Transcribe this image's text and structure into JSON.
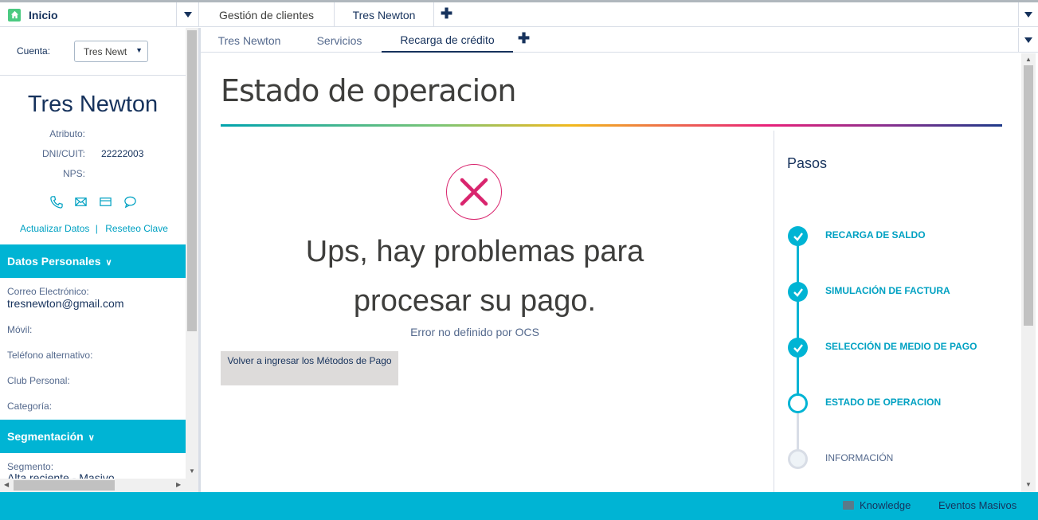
{
  "tabs": {
    "home": "Inicio",
    "workspace": [
      "Gestión de clientes",
      "Tres Newton"
    ]
  },
  "subtabs": [
    "Tres Newton",
    "Servicios",
    "Recarga de crédito"
  ],
  "account": {
    "label": "Cuenta:",
    "selected": "Tres Newt"
  },
  "customer": {
    "name": "Tres Newton",
    "attributes": [
      {
        "label": "Atributo:",
        "value": ""
      },
      {
        "label": "DNI/CUIT:",
        "value": "22222003"
      },
      {
        "label": "NPS:",
        "value": ""
      }
    ],
    "links": {
      "update": "Actualizar Datos",
      "sep": "|",
      "reset": "Reseteo Clave"
    }
  },
  "personal": {
    "title": "Datos Personales",
    "email_label": "Correo Electrónico:",
    "email": "tresnewton@gmail.com",
    "mobile_label": "Móvil:",
    "alt_phone_label": "Teléfono alternativo:",
    "club_label": "Club Personal:",
    "category_label": "Categoría:"
  },
  "segmentation": {
    "title": "Segmentación",
    "segment_label": "Segmento:",
    "segment_value": "Alta reciente - Masivo"
  },
  "main": {
    "title": "Estado de operacion",
    "error_line1": "Ups, hay problemas para",
    "error_line2": "procesar su pago.",
    "error_detail": "Error no definido por OCS",
    "retry_button": "Volver a ingresar los Métodos de Pago"
  },
  "steps": {
    "title": "Pasos",
    "items": [
      {
        "label": "RECARGA DE SALDO",
        "state": "done"
      },
      {
        "label": "SIMULACIÓN DE FACTURA",
        "state": "done"
      },
      {
        "label": "SELECCIÓN DE MEDIO DE PAGO",
        "state": "done"
      },
      {
        "label": "ESTADO DE OPERACION",
        "state": "current"
      },
      {
        "label": "INFORMACIÓN",
        "state": "todo"
      }
    ]
  },
  "footer": {
    "knowledge": "Knowledge",
    "events": "Eventos Masivos"
  },
  "colors": {
    "accent": "#00b4d4",
    "error": "#d9256e",
    "text": "#16325c"
  }
}
